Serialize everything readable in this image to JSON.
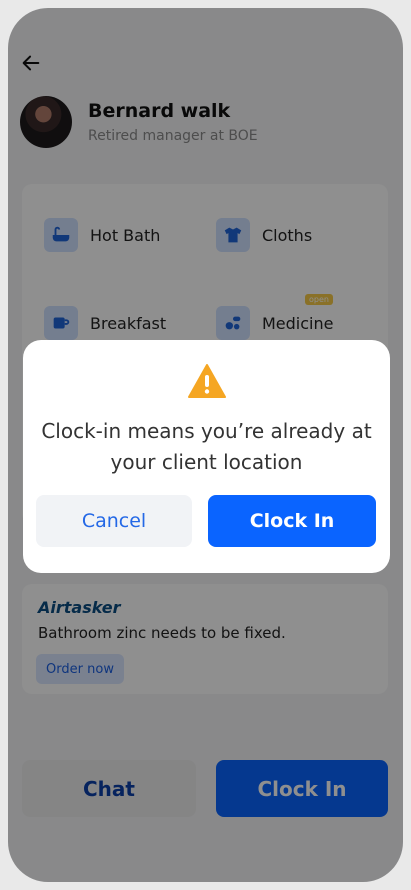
{
  "header": {
    "name": "Bernard walk",
    "subtitle": "Retired manager at BOE"
  },
  "services": [
    {
      "label": "Hot Bath",
      "icon": "bathtub-icon"
    },
    {
      "label": "Cloths",
      "icon": "shirt-icon"
    },
    {
      "label": "Breakfast",
      "icon": "coffee-icon"
    },
    {
      "label": "Medicine",
      "icon": "pills-icon",
      "badge": "open"
    }
  ],
  "task": {
    "brand": "Airtasker",
    "text": "Bathroom zinc needs to be fixed.",
    "order_label": "Order now"
  },
  "footer": {
    "chat_label": "Chat",
    "clock_label": "Clock In"
  },
  "modal": {
    "message": "Clock-in means you’re already at your client location",
    "cancel_label": "Cancel",
    "confirm_label": "Clock In"
  },
  "colors": {
    "primary": "#0a64ff",
    "warning": "#f5a623"
  }
}
